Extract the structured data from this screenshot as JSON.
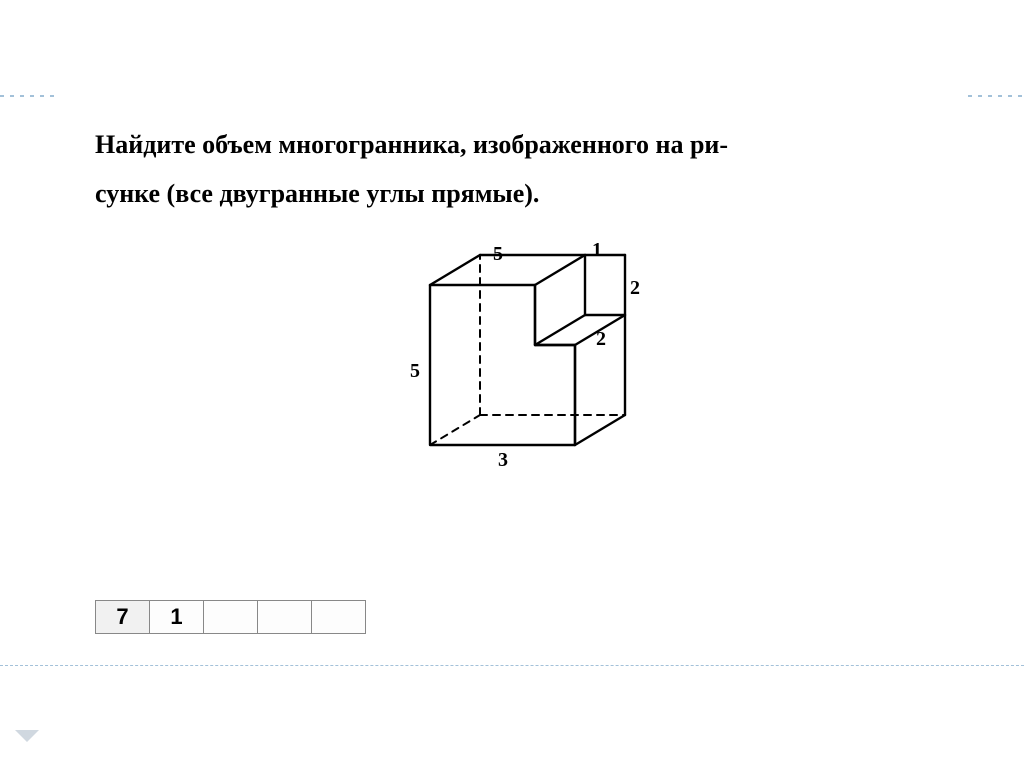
{
  "problem": {
    "line1": "Найдите объем многогранника, изображенного на ри-",
    "line2": "сунке (все двугранные углы прямые)."
  },
  "figure": {
    "labels": {
      "top_depth": "5",
      "notch_width": "1",
      "notch_height": "2",
      "notch_depth": "2",
      "front_height": "5",
      "front_width": "3"
    }
  },
  "answer": {
    "cells": [
      "7",
      "1",
      "",
      "",
      ""
    ]
  }
}
